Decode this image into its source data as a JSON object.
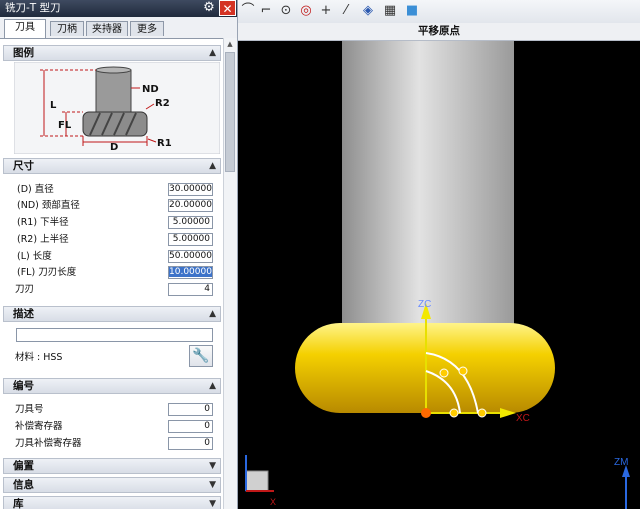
{
  "dialog": {
    "title": "铣刀-T 型刀",
    "tabs": [
      {
        "label": "刀具"
      },
      {
        "label": "刀柄"
      },
      {
        "label": "夹持器"
      },
      {
        "label": "更多"
      }
    ],
    "sections": {
      "legend": "图例",
      "dimensions": "尺寸",
      "description": "描述",
      "numbering": "编号",
      "offset": "偏置",
      "info": "信息",
      "library": "库"
    },
    "diagram_labels": {
      "nd": "ND",
      "r2": "R2",
      "l": "L",
      "fl": "FL",
      "d": "D",
      "r1": "R1"
    },
    "dimensions": [
      {
        "label": "(D) 直径",
        "value": "30.00000"
      },
      {
        "label": "(ND) 颈部直径",
        "value": "20.00000"
      },
      {
        "label": "(R1) 下半径",
        "value": "5.00000"
      },
      {
        "label": "(R2) 上半径",
        "value": "5.00000"
      },
      {
        "label": "(L) 长度",
        "value": "50.00000"
      },
      {
        "label": "(FL) 刀刃长度",
        "value": "10.00000"
      }
    ],
    "flutes": {
      "label": "刀刃",
      "value": "4"
    },
    "description_value": "",
    "material": {
      "label": "材料 : HSS"
    },
    "numbering": [
      {
        "label": "刀具号",
        "value": "0"
      },
      {
        "label": "补偿寄存器",
        "value": "0"
      },
      {
        "label": "刀具补偿寄存器",
        "value": "0"
      }
    ]
  },
  "toolbar": {
    "icons": [
      "curve-icon",
      "line-icon",
      "circle-center-icon",
      "circle-target-icon",
      "plus-icon",
      "slash-icon",
      "view-icon",
      "grid-icon",
      "cube-icon"
    ]
  },
  "viewport": {
    "subtitle": "平移原点",
    "axes": {
      "zc": "ZC",
      "xc": "XC",
      "zm": "ZM",
      "x": "X"
    }
  },
  "colors": {
    "tool_body": "#c9c9c9",
    "cutter": "#f0c000",
    "viewport_bg": "#000000",
    "title_bar": "#2a3345",
    "close": "#d43324"
  }
}
